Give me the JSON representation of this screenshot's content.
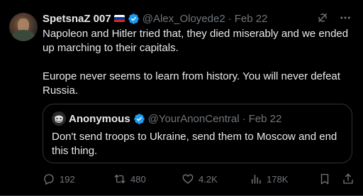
{
  "tweet": {
    "display_name": "SpetsnaZ 007",
    "handle": "@Alex_Oloyede2",
    "separator": "·",
    "date": "Feb 22",
    "paragraphs": [
      "Napoleon and Hitler tried that, they died miserably and we ended up marching to their capitals.",
      "Europe never seems to learn from history. You will never defeat Russia."
    ],
    "flag_icon": "russia-flag-icon",
    "verified_icon": "verified-badge-icon"
  },
  "quote": {
    "display_name": "Anonymous",
    "handle": "@YourAnonCentral",
    "separator": "·",
    "date": "Feb 22",
    "text": "Don't send troops to Ukraine, send them to Moscow and end this thing."
  },
  "actions": {
    "replies": "192",
    "retweets": "480",
    "likes": "4.2K",
    "views": "178K"
  },
  "colors": {
    "background": "#000000",
    "primary_text": "#e7e9ea",
    "secondary_text": "#71767b",
    "border": "#2f3336",
    "verified_blue": "#1d9bf0"
  }
}
